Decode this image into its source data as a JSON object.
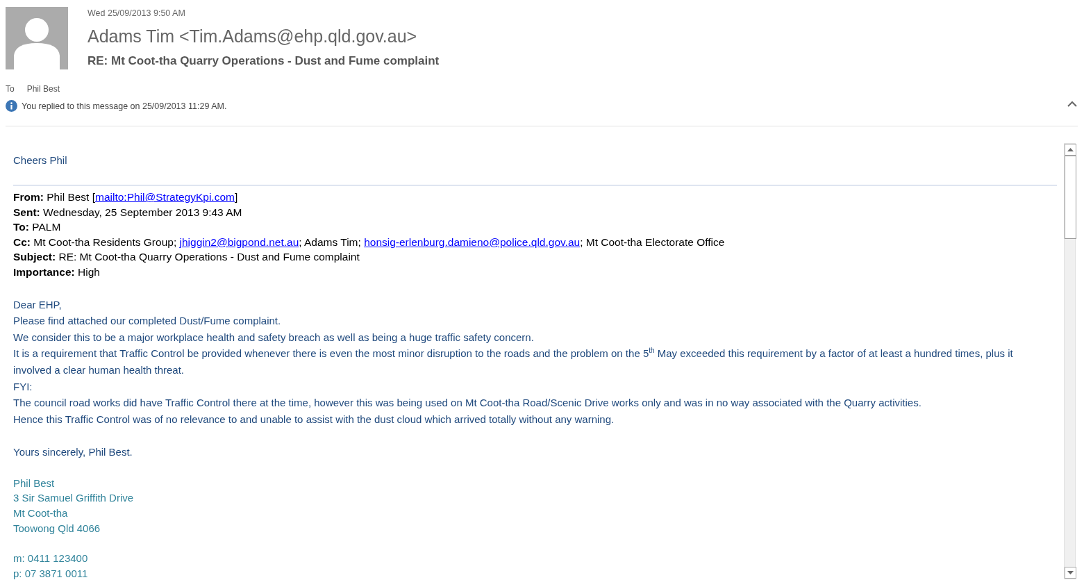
{
  "header": {
    "date": "Wed 25/09/2013 9:50 AM",
    "sender": "Adams Tim <Tim.Adams@ehp.qld.gov.au>",
    "subject": "RE: Mt Coot-tha Quarry Operations - Dust and Fume complaint",
    "to_label": "To",
    "to": "Phil Best",
    "info": "You replied to this message on 25/09/2013 11:29 AM."
  },
  "body": {
    "greeting": "Cheers Phil",
    "quoted_header": [
      {
        "label": "From:",
        "parts": [
          {
            "text": "Phil Best [",
            "link": false
          },
          {
            "text": "mailto:Phil@StrategyKpi.com",
            "link": true
          },
          {
            "text": "]",
            "link": false
          }
        ]
      },
      {
        "label": "Sent:",
        "parts": [
          {
            "text": "Wednesday, 25 September 2013 9:43 AM",
            "link": false
          }
        ]
      },
      {
        "label": "To:",
        "parts": [
          {
            "text": "PALM",
            "link": false
          }
        ]
      },
      {
        "label": "Cc:",
        "parts": [
          {
            "text": "Mt Coot-tha Residents Group; ",
            "link": false
          },
          {
            "text": "jhiggin2@bigpond.net.au",
            "link": true
          },
          {
            "text": "; Adams Tim; ",
            "link": false
          },
          {
            "text": "honsig-erlenburg.damieno@police.qld.gov.au",
            "link": true
          },
          {
            "text": "; Mt Coot-tha Electorate Office",
            "link": false
          }
        ]
      },
      {
        "label": "Subject:",
        "parts": [
          {
            "text": "RE: Mt Coot-tha Quarry Operations - Dust and Fume complaint",
            "link": false
          }
        ]
      },
      {
        "label": "Importance:",
        "parts": [
          {
            "text": "High",
            "link": false
          }
        ]
      }
    ],
    "paragraphs": [
      {
        "kind": "line",
        "text": "Dear EHP,"
      },
      {
        "kind": "line",
        "text": "Please find attached our completed Dust/Fume complaint."
      },
      {
        "kind": "line",
        "text": "We consider this to be a major workplace health and safety breach as well as being a huge traffic safety concern."
      },
      {
        "kind": "line",
        "text": "It is a requirement that Traffic Control be provided whenever there is even the most minor disruption to the roads and the problem on the 5$^{th}$ May exceeded this requirement by a factor of at least a hundred times, plus it involved a clear human health threat."
      },
      {
        "kind": "line",
        "text": "FYI:"
      },
      {
        "kind": "line",
        "text": "The council road works did have Traffic Control there at the time, however this was being used on Mt Coot-tha Road/Scenic Drive works only and was in no way associated with the Quarry activities."
      },
      {
        "kind": "line",
        "text": "Hence this Traffic Control was of no relevance to and unable to assist with the dust cloud which arrived totally without any warning."
      },
      {
        "kind": "gap"
      },
      {
        "kind": "line",
        "text": "Yours sincerely, Phil Best."
      }
    ],
    "signature": [
      {
        "kind": "line",
        "text": "Phil Best"
      },
      {
        "kind": "line",
        "text": "3 Sir Samuel Griffith Drive"
      },
      {
        "kind": "line",
        "text": "Mt Coot-tha"
      },
      {
        "kind": "line",
        "text": "Toowong Qld 4066"
      },
      {
        "kind": "gap"
      },
      {
        "kind": "line",
        "text": "m: 0411 123400"
      },
      {
        "kind": "line",
        "text": "p: 07 3871 0011"
      }
    ]
  }
}
